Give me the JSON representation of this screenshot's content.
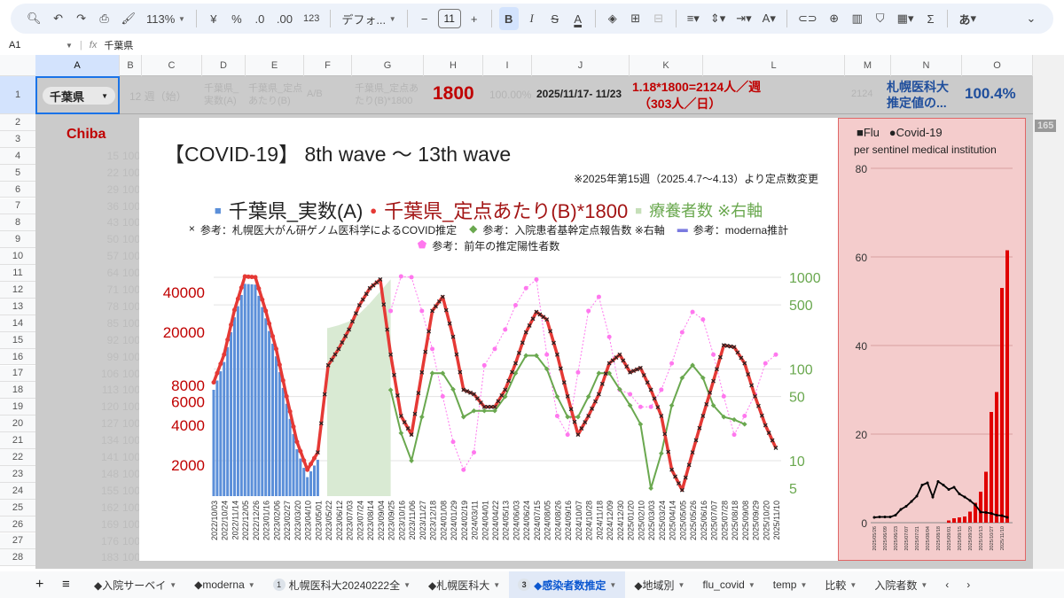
{
  "toolbar": {
    "zoom": "113%",
    "currency": "¥",
    "percent": "%",
    "dec_less": ".0",
    "dec_more": ".00",
    "number_format": "123",
    "font": "デフォ...",
    "font_size": "11",
    "bold": "B",
    "italic": "I",
    "strike": "S",
    "text_color": "A",
    "ime": "あ"
  },
  "formula_bar": {
    "cell_ref": "A1",
    "fx": "fx",
    "value": "千葉県"
  },
  "columns": [
    "A",
    "B",
    "C",
    "D",
    "E",
    "F",
    "G",
    "H",
    "I",
    "J",
    "K",
    "L",
    "M",
    "N",
    "O"
  ],
  "row1": {
    "a_dropdown": "千葉県",
    "c": "12 週（始）",
    "d": "千葉県_実数(A)",
    "e": "千葉県_定点あたり(B)",
    "f": "A/B",
    "g": "千葉県_定点あたり(B)*1800",
    "h": "1800",
    "i": "100.00%",
    "j": "2025/11/17- 11/23",
    "k1": "1.18*1800=2124人／週",
    "k2": "（303人／日）",
    "m": "2124",
    "n": "札幌医科大推定値の...",
    "o": "100.4%"
  },
  "a2": "Chiba",
  "row_numbers": [
    "2",
    "3",
    "4",
    "5",
    "6",
    "7",
    "8",
    "9",
    "10",
    "11",
    "12",
    "13",
    "14",
    "15",
    "16",
    "17",
    "18",
    "19",
    "20",
    "21",
    "22",
    "23",
    "24",
    "25",
    "26",
    "27",
    "28"
  ],
  "col_b_values": [
    "15",
    "22",
    "29",
    "36",
    "43",
    "50",
    "57",
    "64",
    "71",
    "78",
    "85",
    "92",
    "99",
    "106",
    "113",
    "120",
    "127",
    "134",
    "141",
    "148",
    "155",
    "162",
    "169",
    "176",
    "183"
  ],
  "col_c_value": "100",
  "scroll_badge": "165",
  "chart_data": [
    {
      "type": "bar+line",
      "title": "【COVID-19】 8th wave 〜 13th wave",
      "note": "※2025年第15週（2025.4.7〜4.13）より定点数変更",
      "legend": [
        "千葉県_実数(A)",
        "千葉県_定点あたり(B)*1800",
        "療養者数 ※右軸",
        "参考：札幌医大がん研ゲノム医科学によるCOVID推定",
        "参考：入院患者基幹定点報告数 ※右軸",
        "参考：moderna推計",
        "参考：前年の推定陽性者数"
      ],
      "left_ticks": [
        "40000",
        "20000",
        "8000",
        "6000",
        "4000",
        "2000"
      ],
      "left_tick_values": [
        40000,
        20000,
        8000,
        6000,
        4000,
        2000
      ],
      "right_ticks": [
        "1000",
        "500",
        "100",
        "50",
        "10",
        "5"
      ],
      "right_tick_values": [
        1000,
        500,
        100,
        50,
        10,
        5
      ],
      "x": [
        "2022/10/03",
        "2022/10/24",
        "2022/11/14",
        "2022/12/05",
        "2022/12/26",
        "2023/01/16",
        "2023/02/06",
        "2023/02/27",
        "2023/03/20",
        "2023/04/10",
        "2023/05/01",
        "2023/05/22",
        "2023/06/12",
        "2023/07/03",
        "2023/07/24",
        "2023/08/14",
        "2023/09/04",
        "2023/09/25",
        "2023/10/16",
        "2023/11/06",
        "2023/11/27",
        "2023/12/18",
        "2024/01/08",
        "2024/01/29",
        "2024/02/19",
        "2024/03/11",
        "2024/04/01",
        "2024/04/22",
        "2024/05/13",
        "2024/06/03",
        "2024/06/24",
        "2024/07/15",
        "2024/08/05",
        "2024/08/26",
        "2024/09/16",
        "2024/10/07",
        "2024/10/28",
        "2024/11/18",
        "2024/12/09",
        "2024/12/30",
        "2025/01/20",
        "2025/02/10",
        "2025/03/03",
        "2025/03/24",
        "2025/04/14",
        "2025/05/05",
        "2025/05/26",
        "2025/06/16",
        "2025/07/07",
        "2025/07/28",
        "2025/08/18",
        "2025/09/08",
        "2025/09/29",
        "2025/10/20",
        "2025/11/10"
      ],
      "per_sentinel_x1800": [
        8400,
        13600,
        29500,
        52700,
        52000,
        29000,
        15000,
        6600,
        3000,
        1850,
        2500,
        11300,
        15000,
        21000,
        32000,
        43000,
        50000,
        13600,
        4700,
        3400,
        10000,
        29000,
        37000,
        18500,
        7400,
        6850,
        5500,
        5500,
        7400,
        11700,
        20000,
        28500,
        25000,
        13600,
        6600,
        3400,
        4700,
        6850,
        11700,
        13600,
        10000,
        10800,
        7400,
        4700,
        1850,
        1300,
        2500,
        4700,
        8600,
        16000,
        15500,
        11700,
        6600,
        4000,
        2700
      ],
      "actual_count_end_index": 10,
      "recuperating_right": {
        "start_index": 11,
        "values": [
          280,
          300,
          330,
          400,
          520,
          700,
          950
        ]
      },
      "hospitalized_right": {
        "start_index": 17,
        "values": [
          59,
          20,
          10,
          30,
          90,
          90,
          60,
          30,
          35,
          35,
          35,
          50,
          90,
          140,
          140,
          100,
          50,
          30,
          30,
          50,
          90,
          90,
          60,
          40,
          25,
          5,
          12,
          40,
          80,
          110,
          80,
          40,
          30,
          28,
          25
        ]
      },
      "previous_year": {
        "start_index": 17,
        "values": [
          29000,
          52700,
          52000,
          29000,
          15000,
          6600,
          3000,
          1850,
          2500,
          11300,
          15000,
          21000,
          32000,
          43000,
          50000,
          13600,
          4700,
          3400,
          10000,
          29000,
          37000,
          18500,
          7400,
          6850,
          5500,
          5500,
          7400,
          11700,
          20000,
          28500,
          25000,
          13600,
          6600,
          3400,
          4700,
          6850,
          11700,
          13600
        ]
      }
    },
    {
      "type": "bar+line",
      "legend": [
        "■Flu",
        "●Covid-19"
      ],
      "subtitle": "per sentinel medical institution",
      "ylim": [
        0,
        80
      ],
      "y_ticks": [
        "80",
        "60",
        "40",
        "20",
        "0"
      ],
      "x_labels": [
        "2025/05/26",
        "2025/06/09",
        "2025/06/23",
        "2025/07/07",
        "2025/07/21",
        "2025/08/04",
        "2025/08/18",
        "2025/09/01",
        "2025/09/15",
        "2025/09/29",
        "2025/10/13",
        "2025/10/27",
        "2025/11/10"
      ],
      "flu": [
        0,
        0,
        0,
        0,
        0,
        0,
        0,
        0,
        0,
        0,
        0,
        0,
        0,
        0,
        0.5,
        1,
        1.2,
        1.4,
        2.5,
        4.5,
        7,
        11.5,
        25,
        29.5,
        53,
        61.5
      ],
      "covid": [
        1.2,
        1.3,
        1.3,
        1.3,
        1.7,
        3,
        3.7,
        4.8,
        6,
        8.5,
        9,
        5.8,
        9.3,
        8.5,
        7.5,
        8,
        6.5,
        5.8,
        5,
        4,
        2.4,
        2.3,
        2.1,
        1.7,
        1.6,
        1.2
      ]
    }
  ],
  "colors": {
    "blue": "#5b8fd9",
    "red": "#e53935",
    "green": "#6aa84f",
    "area": "#d9ead3",
    "pink": "#ff77ee",
    "darkred": "#c00000"
  },
  "tabs": [
    {
      "label": "◆入院サーベイ"
    },
    {
      "label": "◆moderna"
    },
    {
      "label": "札幌医科大20240222全",
      "badge": "1"
    },
    {
      "label": "◆札幌医科大"
    },
    {
      "label": "◆感染者数推定",
      "badge": "3",
      "active": true
    },
    {
      "label": "◆地域別"
    },
    {
      "label": "flu_covid"
    },
    {
      "label": "temp"
    },
    {
      "label": "比較"
    },
    {
      "label": "入院者数"
    }
  ]
}
